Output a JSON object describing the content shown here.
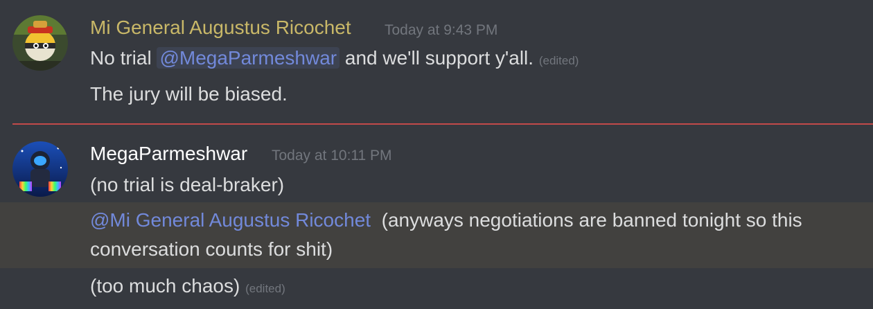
{
  "colors": {
    "background": "#36393f",
    "author1_color": "#c9b868",
    "author2_color": "#ffffff",
    "text": "#dcddde",
    "mention": "#7289da",
    "timestamp": "#72767d",
    "new_divider": "#c34a4a",
    "mention_highlight_row": "#42413f"
  },
  "messages": [
    {
      "author": "Mi General Augustus Ricochet",
      "timestamp": "Today at 9:43 PM",
      "avatar_icon": "countryball-avatar-icon",
      "lines": [
        {
          "pre": "No trial ",
          "mention": "@MegaParmeshwar",
          "post": " and we'll support y'all.",
          "edited": "(edited)"
        },
        {
          "text": "The jury will be biased."
        }
      ]
    },
    {
      "author": "MegaParmeshwar",
      "timestamp": "Today at 10:11 PM",
      "avatar_icon": "astronaut-avatar-icon",
      "lines": [
        {
          "text": "(no trial is deal-braker)"
        },
        {
          "mention": "@Mi General Augustus Ricochet",
          "post_line1": "(anyways negotiations are banned tonight so this",
          "post_line2": "conversation counts for shit)"
        },
        {
          "text": "(too much chaos)",
          "edited": "(edited)"
        }
      ]
    }
  ]
}
